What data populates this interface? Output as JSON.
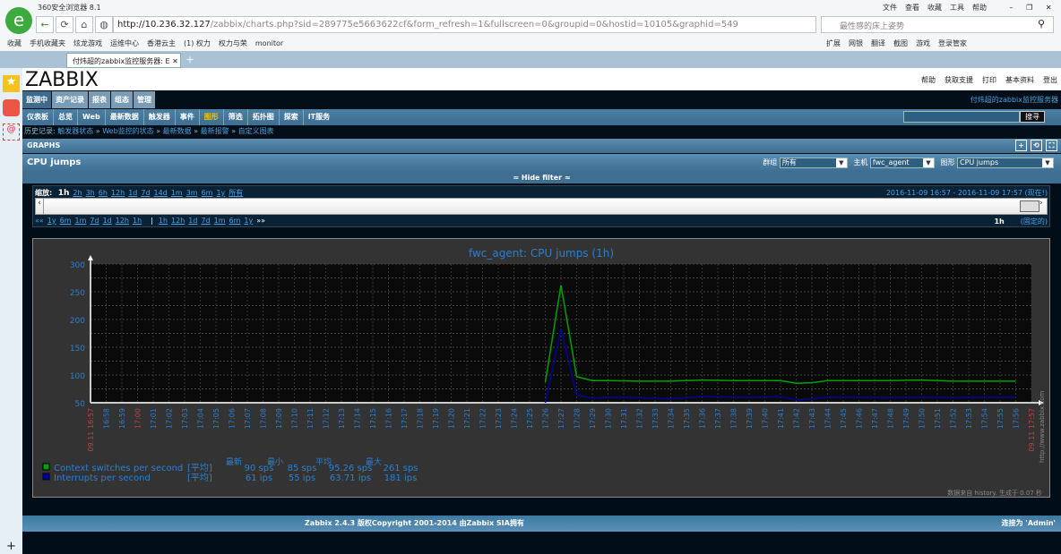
{
  "browser": {
    "title": "360安全浏览器 8.1",
    "url_host": "http://10.236.32.127",
    "url_path": "/zabbix/charts.php?sid=289775e5663622cf&form_refresh=1&fullscreen=0&groupid=0&hostid=10105&graphid=549",
    "search_placeholder": "最性感的床上姿势",
    "menu": [
      "文件",
      "查看",
      "收藏",
      "工具",
      "帮助"
    ],
    "bookmarks": [
      "收藏",
      "手机收藏夹",
      "炫龙游戏",
      "运维中心",
      "香港云主",
      "(1) 权力",
      "权力与荣",
      "monitor"
    ],
    "tools": [
      "扩展",
      "网银",
      "翻译",
      "截图",
      "游戏",
      "登录管家"
    ],
    "tab_title": "付炜超的zabbix监控服务器: E"
  },
  "header": {
    "logo": "ZABBIX",
    "links": [
      "帮助",
      "获取支援",
      "打印",
      "基本资料",
      "登出"
    ],
    "server_name": "付炜超的zabbix监控服务器"
  },
  "menu": [
    "监测中",
    "资产记录",
    "报表",
    "组态",
    "管理"
  ],
  "submenu": [
    "仪表板",
    "总览",
    "Web",
    "最新数据",
    "触发器",
    "事件",
    "图形",
    "筛选",
    "拓扑图",
    "探索",
    "IT服务"
  ],
  "search_button": "搜寻",
  "history": {
    "label": "历史记录:",
    "items": [
      "触发器状态",
      "Web监控的状态",
      "最新数据",
      "最新报警",
      "自定义图表"
    ]
  },
  "section": "GRAPHS",
  "page_title": "CPU jumps",
  "filters": {
    "group_label": "群组",
    "group": "所有",
    "host_label": "主机",
    "host": "fwc_agent",
    "graph_label": "图形",
    "graph": "CPU jumps"
  },
  "hide_filter": "Hide filter",
  "zoom": {
    "label": "缩放:",
    "current": "1h",
    "options": [
      "2h",
      "3h",
      "6h",
      "12h",
      "1d",
      "7d",
      "14d",
      "1m",
      "3m",
      "6m",
      "1y",
      "所有"
    ],
    "back": [
      "1y",
      "6m",
      "1m",
      "7d",
      "1d",
      "12h",
      "1h"
    ],
    "fwd": [
      "1h",
      "12h",
      "1d",
      "7d",
      "1m",
      "6m",
      "1y"
    ],
    "from": "2016-11-09 16:57",
    "to": "2016-11-09 17:57 (现在!)",
    "period": "1h",
    "fixed": "(固定的)"
  },
  "chart_data": {
    "type": "line",
    "title": "fwc_agent: CPU jumps (1h)",
    "ylim": [
      50,
      300
    ],
    "yticks": [
      "300",
      "250",
      "200",
      "150",
      "100",
      "50"
    ],
    "xlim": [
      "16:57",
      "17:57"
    ],
    "start_label": "09.11 16:57",
    "end_label": "09.11 17:57",
    "grid": true,
    "watermark": "http://www.zabbix.com",
    "footnote": "数据来自 history. 生成于 0.07 秒",
    "stat_headers": [
      "最新",
      "最小",
      "平均",
      "最大"
    ],
    "series": [
      {
        "name": "Context switches per second",
        "color": "#00a000",
        "func": "[平均]",
        "stats": [
          "90 sps",
          "85 sps",
          "95.26 sps",
          "261 sps"
        ],
        "x": [
          "17:26",
          "17:27",
          "17:28",
          "17:29",
          "17:30",
          "17:32",
          "17:34",
          "17:36",
          "17:38",
          "17:40",
          "17:41",
          "17:42",
          "17:43",
          "17:44",
          "17:46",
          "17:48",
          "17:50",
          "17:52",
          "17:54",
          "17:56"
        ],
        "values": [
          87,
          262,
          97,
          90,
          90,
          89,
          89,
          91,
          90,
          90,
          90,
          85,
          86,
          90,
          90,
          90,
          91,
          89,
          89,
          89
        ]
      },
      {
        "name": "Interrupts per second",
        "color": "#0000a0",
        "func": "[平均]",
        "stats": [
          "61 ips",
          "55 ips",
          "63.71 ips",
          "181 ips"
        ],
        "x": [
          "17:26",
          "17:27",
          "17:28",
          "17:29",
          "17:30",
          "17:32",
          "17:34",
          "17:36",
          "17:38",
          "17:40",
          "17:41",
          "17:42",
          "17:43",
          "17:44",
          "17:46",
          "17:48",
          "17:50",
          "17:52",
          "17:54",
          "17:56"
        ],
        "values": [
          50,
          183,
          64,
          58,
          60,
          59,
          57,
          61,
          60,
          60,
          61,
          55,
          57,
          60,
          60,
          59,
          60,
          59,
          60,
          60
        ]
      }
    ]
  },
  "footer": {
    "copyright": "Zabbix 2.4.3 版权Copyright 2001-2014 由Zabbix SIA拥有",
    "user": "连接为 'Admin'"
  }
}
